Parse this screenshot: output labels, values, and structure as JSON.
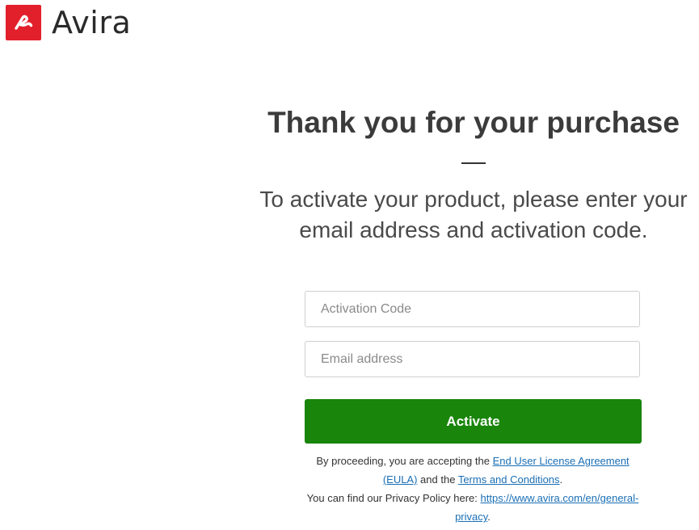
{
  "brand": {
    "logo_icon": "avira-umbrella-icon",
    "name": "Avira",
    "color": "#e2202b"
  },
  "main": {
    "title": "Thank you for your purchase",
    "subtitle_line1": "To activate your product, please enter your",
    "subtitle_line2": "email address and activation code."
  },
  "form": {
    "activation_placeholder": "Activation Code",
    "activation_value": "",
    "email_placeholder": "Email address",
    "email_value": "",
    "activate_label": "Activate",
    "activate_color": "#19850b"
  },
  "legal": {
    "prefix": "By proceeding, you are accepting the ",
    "eula_link": "End User License Agreement (EULA)",
    "middle": " and the ",
    "terms_link": "Terms and Conditions",
    "suffix": ".",
    "privacy_prefix": "You can find our Privacy Policy here: ",
    "privacy_link": "https://www.avira.com/en/general-privacy",
    "privacy_suffix": ".",
    "link_color": "#1a6fb5"
  }
}
